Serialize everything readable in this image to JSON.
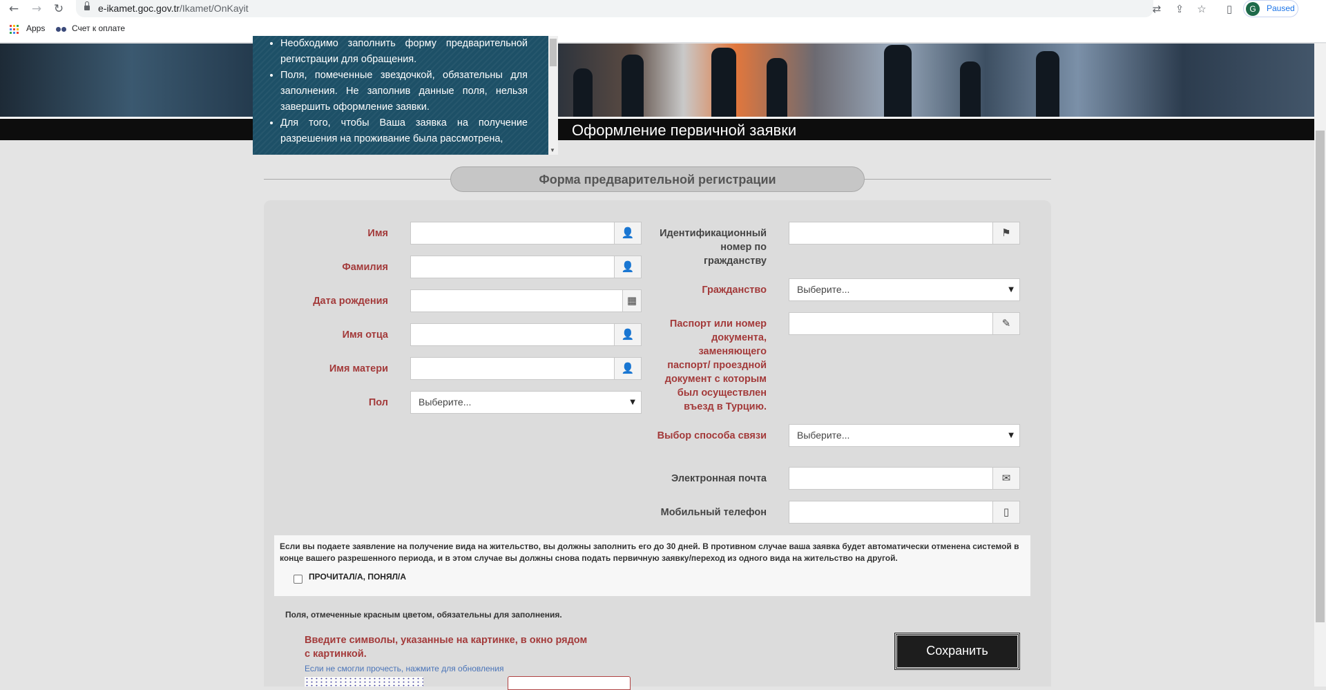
{
  "browser": {
    "url_host": "e-ikamet.goc.gov.tr",
    "url_path": "/Ikamet/OnKayit",
    "profile_initial": "G",
    "profile_status": "Paused",
    "bookmarks": [
      {
        "label": "Apps"
      },
      {
        "label": "Счет к оплате"
      }
    ]
  },
  "banner": {
    "title": "Оформление первичной заявки",
    "notices": [
      "Необходимо заполнить форму предварительной регистрации для обращения.",
      "Поля, помеченные звездочкой, обязательны для заполнения. Не заполнив данные поля, нельзя завершить оформление заявки.",
      "Для того, чтобы Ваша заявка на получение разрешения на проживание была рассмотрена,"
    ]
  },
  "form": {
    "section_title": "Форма предварительной регистрации",
    "left": {
      "first_name": "Имя",
      "last_name": "Фамилия",
      "birth_date": "Дата рождения",
      "father_name": "Имя отца",
      "mother_name": "Имя матери",
      "gender": "Пол",
      "gender_value": "Выберите..."
    },
    "right": {
      "id_number": "Идентификационный номер по гражданству",
      "citizenship": "Гражданство",
      "citizenship_value": "Выберите...",
      "passport": "Паспорт или номер документа, заменяющего паспорт/ проездной документ с которым был осуществлен въезд в Турцию.",
      "contact_method": "Выбор способа связи",
      "contact_method_value": "Выберите...",
      "email": "Электронная почта",
      "mobile": "Мобильный телефон"
    },
    "notice": "Если вы подаете заявление на получение вида на жительство, вы должны заполнить его до 30 дней. В противном случае ваша заявка будет автоматически отменена системой в конце вашего разрешенного периода, и в этом случае вы должны снова подать первичную заявку/переход из одного вида на жительство на другой.",
    "agree_label": "ПРОЧИТАЛ/А, ПОНЯЛ/А",
    "required_note": "Поля, отмеченные красным цветом, обязательны для заполнения.",
    "captcha_title": "Введите символы, указанные на картинке, в окно рядом с картинкой.",
    "captcha_refresh": "Если не смогли прочесть, нажмите для обновления",
    "save_label": "Сохранить"
  },
  "colors": {
    "required_label": "#a33a3a",
    "notice_panel": "#1d5067",
    "save_button": "#1d1d1d",
    "link": "#4a74b8"
  }
}
